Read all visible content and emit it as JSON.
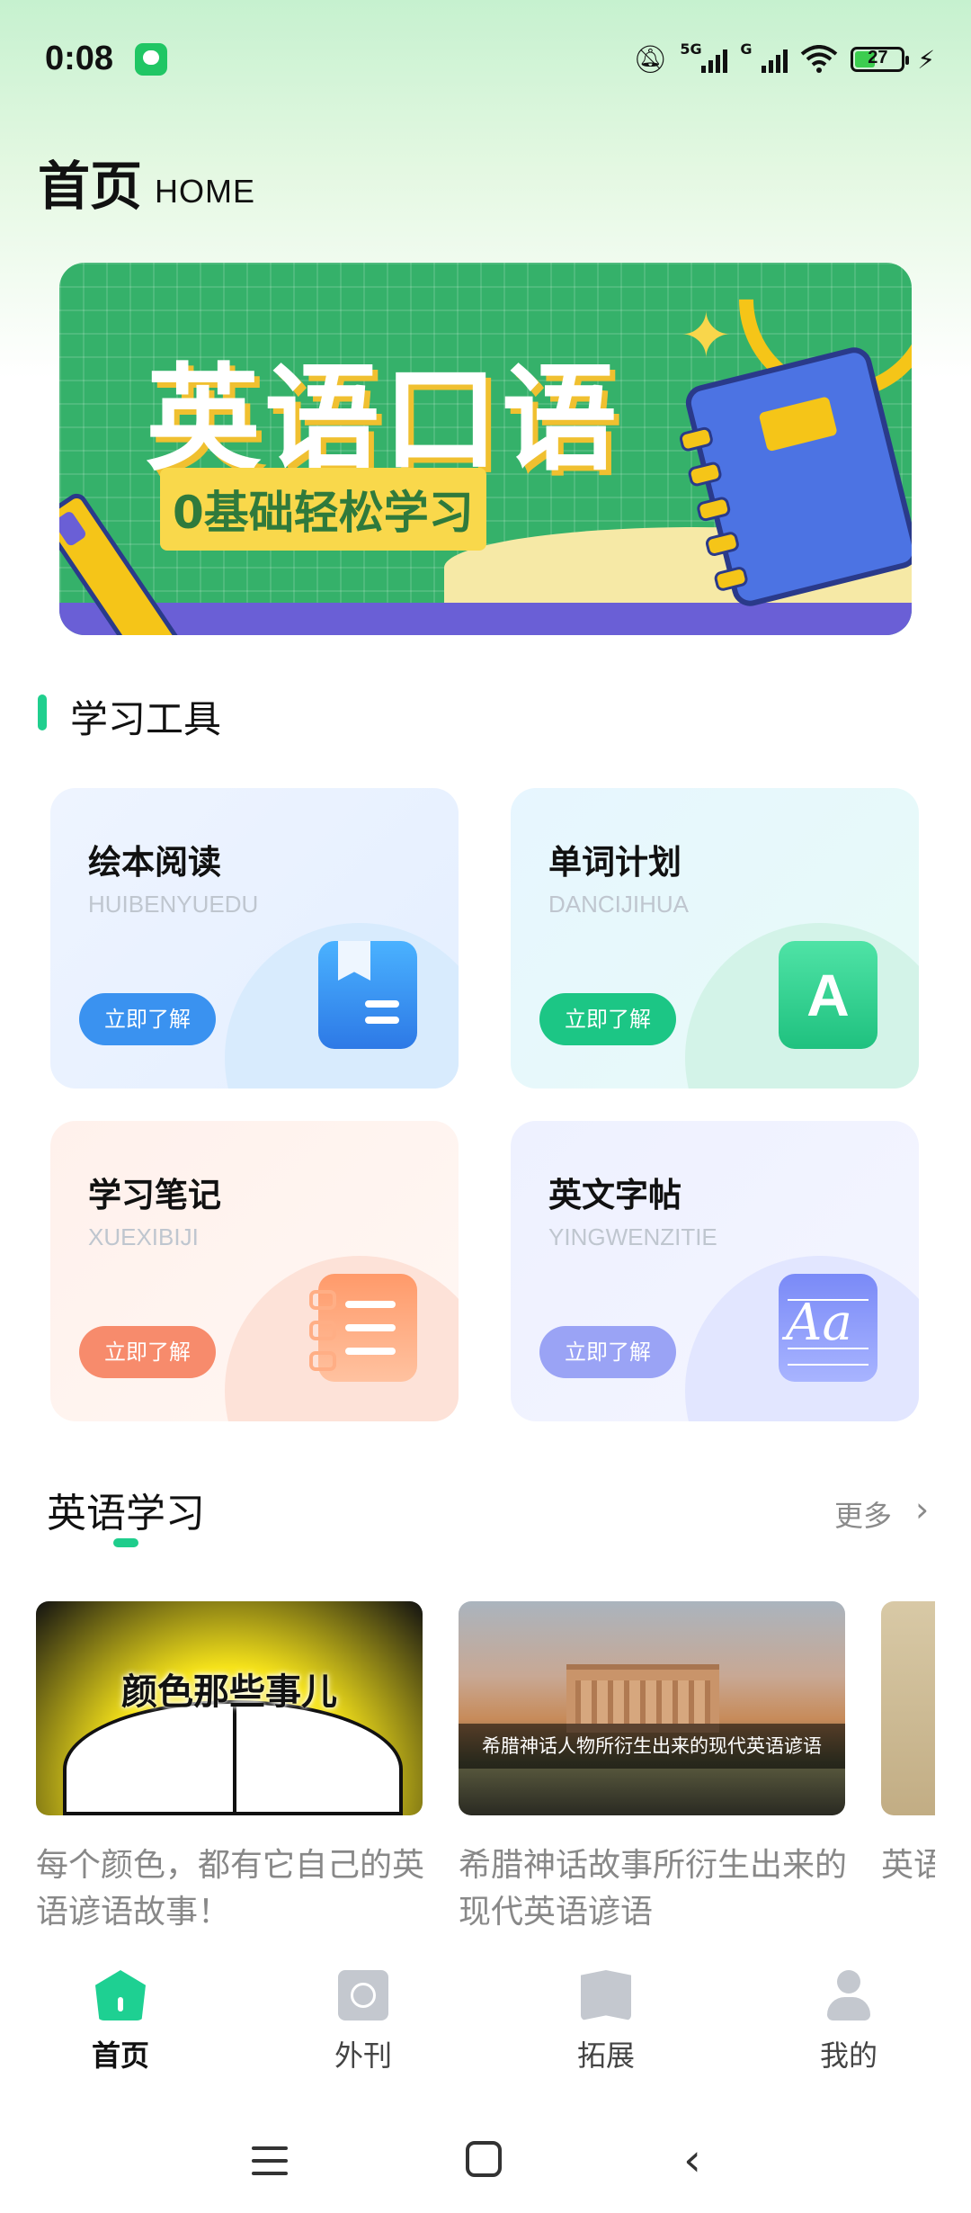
{
  "status_bar": {
    "time": "0:08",
    "net1": "5G",
    "net2": "G",
    "battery": "27"
  },
  "header": {
    "title": "首页",
    "subtitle": "HOME"
  },
  "banner": {
    "title": "英语口语",
    "subtitle": "0基础轻松学习"
  },
  "tools_section": {
    "title": "学习工具",
    "cards": [
      {
        "name": "绘本阅读",
        "pinyin": "HUIBENYUEDU",
        "button": "立即了解",
        "icon": "book-icon"
      },
      {
        "name": "单词计划",
        "pinyin": "DANCIJIHUA",
        "button": "立即了解",
        "icon": "letter-a-icon"
      },
      {
        "name": "学习笔记",
        "pinyin": "XUEXIBIJI",
        "button": "立即了解",
        "icon": "notebook-icon"
      },
      {
        "name": "英文字帖",
        "pinyin": "YINGWENZITIE",
        "button": "立即了解",
        "icon": "copybook-icon"
      }
    ]
  },
  "english_section": {
    "title": "英语学习",
    "more": "更多",
    "articles": [
      {
        "image_text": "颜色那些事儿",
        "caption": "每个颜色，都有它自己的英语谚语故事！"
      },
      {
        "image_text": "希腊神话人物所衍生出来的现代英语谚语",
        "caption": "希腊神话故事所衍生出来的现代英语谚语"
      },
      {
        "image_text": "",
        "caption": "英语典故"
      }
    ]
  },
  "bottom_nav": {
    "items": [
      {
        "label": "首页",
        "icon": "home-icon",
        "active": true
      },
      {
        "label": "外刊",
        "icon": "journal-icon",
        "active": false
      },
      {
        "label": "拓展",
        "icon": "map-book-icon",
        "active": false
      },
      {
        "label": "我的",
        "icon": "profile-icon",
        "active": false
      }
    ]
  },
  "colors": {
    "accent": "#1ed092",
    "banner_green": "#35b16a",
    "banner_yellow": "#f9d84b"
  }
}
